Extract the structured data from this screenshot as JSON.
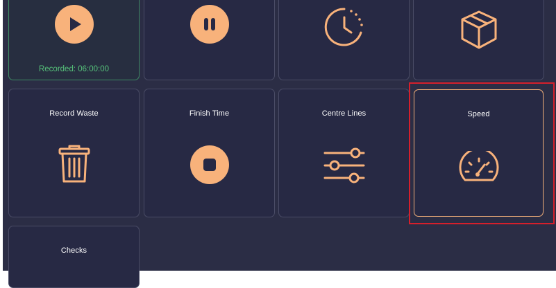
{
  "tiles": {
    "play": {
      "sub_text": "Recorded: 06:00:00"
    },
    "record_waste": {
      "label": "Record Waste"
    },
    "finish_time": {
      "label": "Finish Time"
    },
    "centre_lines": {
      "label": "Centre Lines"
    },
    "speed": {
      "label": "Speed"
    },
    "checks": {
      "label": "Checks"
    }
  },
  "icons": {
    "play": "play-icon",
    "pause": "pause-icon",
    "clock": "clock-icon",
    "package": "package-icon",
    "trash": "trash-icon",
    "stop": "stop-icon",
    "sliders": "sliders-icon",
    "speedometer": "speedometer-icon"
  },
  "colors": {
    "accent": "#f8b27b",
    "tile_background": "#272944",
    "tile_border": "#4a4c66",
    "active_border": "#3e8a63",
    "recorded_text": "#56c27a",
    "highlight": "#d61f2b"
  }
}
